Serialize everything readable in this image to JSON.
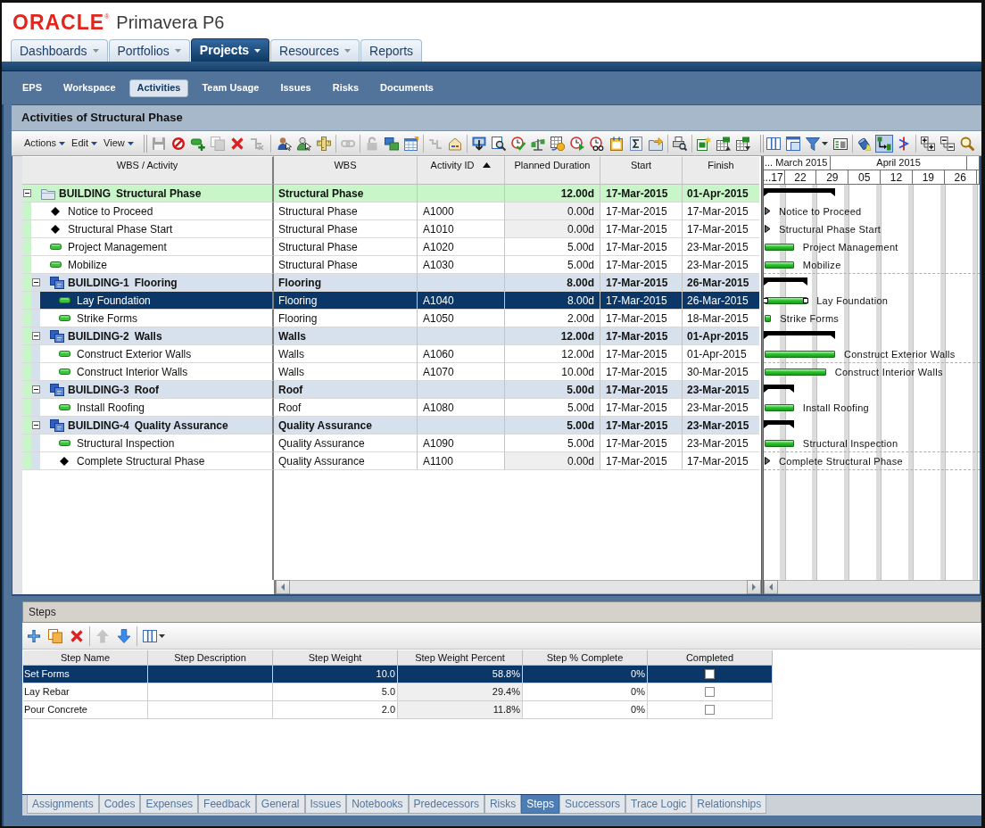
{
  "header": {
    "brand": "ORACLE",
    "mark": "®",
    "product": "Primavera P6"
  },
  "main_tabs": [
    {
      "label": "Dashboards",
      "menu": true,
      "selected": false
    },
    {
      "label": "Portfolios",
      "menu": true,
      "selected": false
    },
    {
      "label": "Projects",
      "menu": true,
      "selected": true
    },
    {
      "label": "Resources",
      "menu": true,
      "selected": false
    },
    {
      "label": "Reports",
      "menu": false,
      "selected": false
    }
  ],
  "sub_tabs": [
    {
      "label": "EPS",
      "selected": false
    },
    {
      "label": "Workspace",
      "selected": false
    },
    {
      "label": "Activities",
      "selected": true
    },
    {
      "label": "Team Usage",
      "selected": false
    },
    {
      "label": "Issues",
      "selected": false
    },
    {
      "label": "Risks",
      "selected": false
    },
    {
      "label": "Documents",
      "selected": false
    }
  ],
  "panel": {
    "title": "Activities of Structural Phase"
  },
  "toolbar": {
    "menus": [
      {
        "label": "Actions"
      },
      {
        "label": "Edit"
      },
      {
        "label": "View"
      }
    ],
    "groups": [
      [
        {
          "kind": "save",
          "disabled": true
        },
        {
          "kind": "cancel",
          "disabled": false
        },
        {
          "kind": "add",
          "disabled": false
        },
        {
          "kind": "copy",
          "disabled": true
        },
        {
          "kind": "delete",
          "disabled": false
        },
        {
          "kind": "dissolve",
          "disabled": true
        }
      ],
      [
        {
          "kind": "assign_user",
          "disabled": false
        },
        {
          "kind": "assign_role",
          "disabled": false
        },
        {
          "kind": "ruler",
          "disabled": false
        }
      ],
      [
        {
          "kind": "handshake",
          "disabled": true
        }
      ],
      [
        {
          "kind": "lock",
          "disabled": true
        },
        {
          "kind": "folders",
          "disabled": false
        },
        {
          "kind": "calendar",
          "disabled": false
        }
      ],
      [
        {
          "kind": "link",
          "disabled": true
        },
        {
          "kind": "envelope",
          "disabled": false
        }
      ],
      [
        {
          "kind": "monitor",
          "disabled": false
        },
        {
          "kind": "magnify_doc",
          "disabled": false
        },
        {
          "kind": "clock_check",
          "disabled": false
        },
        {
          "kind": "balance",
          "disabled": false
        },
        {
          "kind": "dollar_grid",
          "disabled": false
        },
        {
          "kind": "clock_play",
          "disabled": false
        },
        {
          "kind": "clock_glasses",
          "disabled": false
        },
        {
          "kind": "calendar_doc",
          "disabled": false
        },
        {
          "kind": "sigma",
          "disabled": false
        },
        {
          "kind": "folder_arrow",
          "disabled": false
        }
      ],
      [
        {
          "kind": "print_preview",
          "disabled": false
        }
      ],
      [
        {
          "kind": "excel_new",
          "disabled": false
        },
        {
          "kind": "excel_up",
          "disabled": false
        },
        {
          "kind": "excel_down",
          "disabled": false
        }
      ]
    ],
    "chart_tools": [
      [
        {
          "kind": "columns",
          "on": false
        },
        {
          "kind": "layout",
          "on": false
        },
        {
          "kind": "filter",
          "on": false
        },
        {
          "kind": "print_list",
          "on": false
        }
      ],
      [
        {
          "kind": "paint",
          "on": false
        },
        {
          "kind": "relationships",
          "on": true
        },
        {
          "kind": "progress_line",
          "on": false
        }
      ],
      [
        {
          "kind": "expand",
          "on": false
        },
        {
          "kind": "collapse",
          "on": false
        },
        {
          "kind": "zoom",
          "on": false
        }
      ]
    ]
  },
  "grid": {
    "columns": [
      {
        "label": "WBS / Activity",
        "sorted": false
      },
      {
        "label": "WBS",
        "sorted": false
      },
      {
        "label": "Activity ID",
        "sorted": true
      },
      {
        "label": "Planned Duration",
        "sorted": false
      },
      {
        "label": "Start",
        "sorted": false
      },
      {
        "label": "Finish",
        "sorted": false
      }
    ],
    "rows": [
      {
        "kind": "wbs",
        "code": "BUILDING",
        "name": "Structural Phase",
        "expanded": true,
        "selected": false,
        "wbs": "Structural Phase",
        "planned_duration": "12.00d",
        "start": "17-Mar-2015",
        "finish": "01-Apr-2015",
        "children": [
          {
            "kind": "milestone",
            "name": "Notice to Proceed",
            "selected": false,
            "wbs": "Structural Phase",
            "activity_id": "A1000",
            "planned_duration": "0.00d",
            "start": "17-Mar-2015",
            "finish": "17-Mar-2015",
            "bar_label": "Notice to Proceed"
          },
          {
            "kind": "milestone",
            "name": "Structural Phase Start",
            "selected": false,
            "wbs": "Structural Phase",
            "activity_id": "A1010",
            "planned_duration": "0.00d",
            "start": "17-Mar-2015",
            "finish": "17-Mar-2015",
            "bar_label": "Structural Phase Start"
          },
          {
            "kind": "task",
            "name": "Project Management",
            "selected": false,
            "wbs": "Structural Phase",
            "activity_id": "A1020",
            "planned_duration": "5.00d",
            "start": "17-Mar-2015",
            "finish": "23-Mar-2015",
            "bar_label": "Project Management"
          },
          {
            "kind": "task",
            "name": "Mobilize",
            "selected": false,
            "wbs": "Structural Phase",
            "activity_id": "A1030",
            "planned_duration": "5.00d",
            "start": "17-Mar-2015",
            "finish": "23-Mar-2015",
            "bar_label": "Mobilize"
          },
          {
            "kind": "wbs",
            "code": "BUILDING-1",
            "name": "Flooring",
            "expanded": true,
            "selected": false,
            "wbs": "Flooring",
            "planned_duration": "8.00d",
            "start": "17-Mar-2015",
            "finish": "26-Mar-2015",
            "children": [
              {
                "kind": "task",
                "name": "Lay Foundation",
                "selected": true,
                "wbs": "Flooring",
                "activity_id": "A1040",
                "planned_duration": "8.00d",
                "start": "17-Mar-2015",
                "finish": "26-Mar-2015",
                "bar_label": "Lay Foundation"
              },
              {
                "kind": "task",
                "name": "Strike Forms",
                "selected": false,
                "wbs": "Flooring",
                "activity_id": "A1050",
                "planned_duration": "2.00d",
                "start": "17-Mar-2015",
                "finish": "18-Mar-2015",
                "bar_label": "Strike Forms"
              }
            ]
          },
          {
            "kind": "wbs",
            "code": "BUILDING-2",
            "name": "Walls",
            "expanded": true,
            "selected": false,
            "wbs": "Walls",
            "planned_duration": "12.00d",
            "start": "17-Mar-2015",
            "finish": "01-Apr-2015",
            "children": [
              {
                "kind": "task",
                "name": "Construct Exterior Walls",
                "selected": false,
                "wbs": "Walls",
                "activity_id": "A1060",
                "planned_duration": "12.00d",
                "start": "17-Mar-2015",
                "finish": "01-Apr-2015",
                "bar_label": "Construct Exterior Walls"
              },
              {
                "kind": "task",
                "name": "Construct Interior Walls",
                "selected": false,
                "wbs": "Walls",
                "activity_id": "A1070",
                "planned_duration": "10.00d",
                "start": "17-Mar-2015",
                "finish": "30-Mar-2015",
                "bar_label": "Construct Interior Walls"
              }
            ]
          },
          {
            "kind": "wbs",
            "code": "BUILDING-3",
            "name": "Roof",
            "expanded": true,
            "selected": false,
            "wbs": "Roof",
            "planned_duration": "5.00d",
            "start": "17-Mar-2015",
            "finish": "23-Mar-2015",
            "children": [
              {
                "kind": "task",
                "name": "Install Roofing",
                "selected": false,
                "wbs": "Roof",
                "activity_id": "A1080",
                "planned_duration": "5.00d",
                "start": "17-Mar-2015",
                "finish": "23-Mar-2015",
                "bar_label": "Install Roofing"
              }
            ]
          },
          {
            "kind": "wbs",
            "code": "BUILDING-4",
            "name": "Quality Assurance",
            "expanded": true,
            "selected": false,
            "wbs": "Quality Assurance",
            "planned_duration": "5.00d",
            "start": "17-Mar-2015",
            "finish": "23-Mar-2015",
            "children": [
              {
                "kind": "task",
                "name": "Structural Inspection",
                "selected": false,
                "wbs": "Quality Assurance",
                "activity_id": "A1090",
                "planned_duration": "5.00d",
                "start": "17-Mar-2015",
                "finish": "23-Mar-2015",
                "bar_label": "Structural Inspection"
              },
              {
                "kind": "milestone",
                "name": "Complete Structural Phase",
                "selected": false,
                "wbs": "Quality Assurance",
                "activity_id": "A1100",
                "planned_duration": "0.00d",
                "start": "17-Mar-2015",
                "finish": "17-Mar-2015",
                "bar_label": "Complete Structural Phase"
              }
            ]
          }
        ]
      }
    ]
  },
  "gantt": {
    "months": [
      "... March 2015",
      "April 2015"
    ],
    "weeks": [
      "...17",
      "22",
      "29",
      "05",
      "12",
      "19",
      "26"
    ]
  },
  "steps": {
    "title": "Steps",
    "toolbar": [
      [
        {
          "kind": "add_step",
          "disabled": false
        },
        {
          "kind": "copy",
          "disabled": false
        },
        {
          "kind": "delete",
          "disabled": false
        }
      ],
      [
        {
          "kind": "move_up",
          "disabled": true
        },
        {
          "kind": "move_down",
          "disabled": false
        }
      ],
      [
        {
          "kind": "columns_menu",
          "disabled": false
        }
      ]
    ],
    "columns": [
      {
        "label": "Step Name"
      },
      {
        "label": "Step Description"
      },
      {
        "label": "Step Weight"
      },
      {
        "label": "Step Weight Percent"
      },
      {
        "label": "Step % Complete"
      },
      {
        "label": "Completed"
      }
    ],
    "rows": [
      {
        "name": "Set Forms",
        "weight": "10.0",
        "weight_percent": "58.8%",
        "percent_complete": "0%",
        "completed": false,
        "selected": true
      },
      {
        "name": "Lay Rebar",
        "weight": "5.0",
        "weight_percent": "29.4%",
        "percent_complete": "0%",
        "completed": false,
        "selected": false
      },
      {
        "name": "Pour Concrete",
        "weight": "2.0",
        "weight_percent": "11.8%",
        "percent_complete": "0%",
        "completed": false,
        "selected": false
      }
    ]
  },
  "detail_tabs": [
    {
      "label": "Assignments",
      "selected": false
    },
    {
      "label": "Codes",
      "selected": false
    },
    {
      "label": "Expenses",
      "selected": false
    },
    {
      "label": "Feedback",
      "selected": false
    },
    {
      "label": "General",
      "selected": false
    },
    {
      "label": "Issues",
      "selected": false
    },
    {
      "label": "Notebooks",
      "selected": false
    },
    {
      "label": "Predecessors",
      "selected": false
    },
    {
      "label": "Risks",
      "selected": false
    },
    {
      "label": "Steps",
      "selected": true
    },
    {
      "label": "Successors",
      "selected": false
    },
    {
      "label": "Trace Logic",
      "selected": false
    },
    {
      "label": "Relationships",
      "selected": false
    }
  ]
}
